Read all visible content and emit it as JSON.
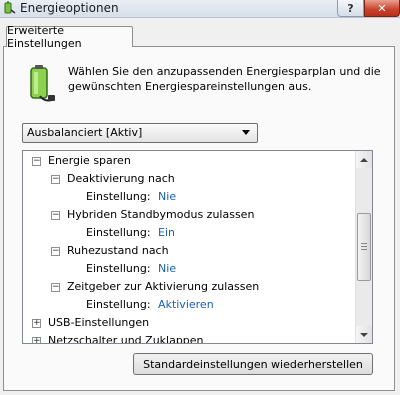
{
  "window": {
    "title": "Energieoptionen",
    "help_label": "?",
    "close_label": "✕"
  },
  "tab": {
    "label": "Erweiterte Einstellungen"
  },
  "description": "Wählen Sie den anzupassenden Energiesparplan und die gewünschten Energiespareinstellungen aus.",
  "plan": {
    "selected": "Ausbalanciert [Aktiv]"
  },
  "tree": {
    "energy": {
      "label": "Energie sparen",
      "deactivation": {
        "label": "Deaktivierung nach",
        "setting_label": "Einstellung:",
        "value": "Nie"
      },
      "hybrid": {
        "label": "Hybriden Standbymodus zulassen",
        "setting_label": "Einstellung:",
        "value": "Ein"
      },
      "hibernate": {
        "label": "Ruhezustand nach",
        "setting_label": "Einstellung:",
        "value": "Nie"
      },
      "timer": {
        "label": "Zeitgeber zur Aktivierung zulassen",
        "setting_label": "Einstellung:",
        "value": "Aktivieren"
      }
    },
    "usb": {
      "label": "USB-Einstellungen"
    },
    "power_buttons": {
      "label": "Netzschalter und Zuklappen"
    }
  },
  "restore_button": {
    "label": "Standardeinstellungen wiederherstellen"
  },
  "colors": {
    "value_link": "#1a5fb4",
    "close_button": "#c8412a"
  },
  "icons": [
    "power-options-icon",
    "battery-plug-icon"
  ]
}
